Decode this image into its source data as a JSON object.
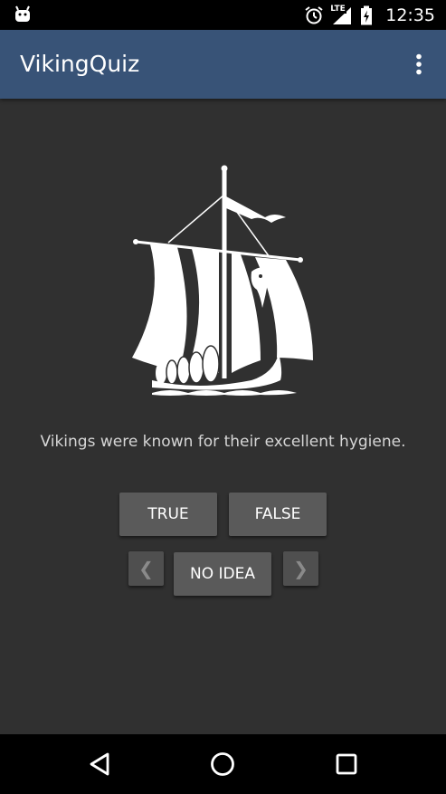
{
  "status_bar": {
    "network_label": "LTE",
    "time": "12:35",
    "icons": [
      "android-debug-icon",
      "alarm-icon",
      "signal-icon",
      "battery-charging-icon"
    ]
  },
  "app_bar": {
    "title": "VikingQuiz",
    "overflow_icon": "more-vert-icon"
  },
  "question": {
    "image": "viking-ship-icon",
    "text": "Vikings were known for their excellent hygiene."
  },
  "buttons": {
    "true_label": "TRUE",
    "false_label": "FALSE",
    "no_idea_label": "NO IDEA",
    "prev_glyph": "❮",
    "next_glyph": "❯"
  },
  "nav_bar": {
    "icons": [
      "back-icon",
      "home-icon",
      "recents-icon"
    ]
  },
  "colors": {
    "app_bar": "#385377",
    "background": "#303030",
    "button": "#5a5a5a"
  }
}
